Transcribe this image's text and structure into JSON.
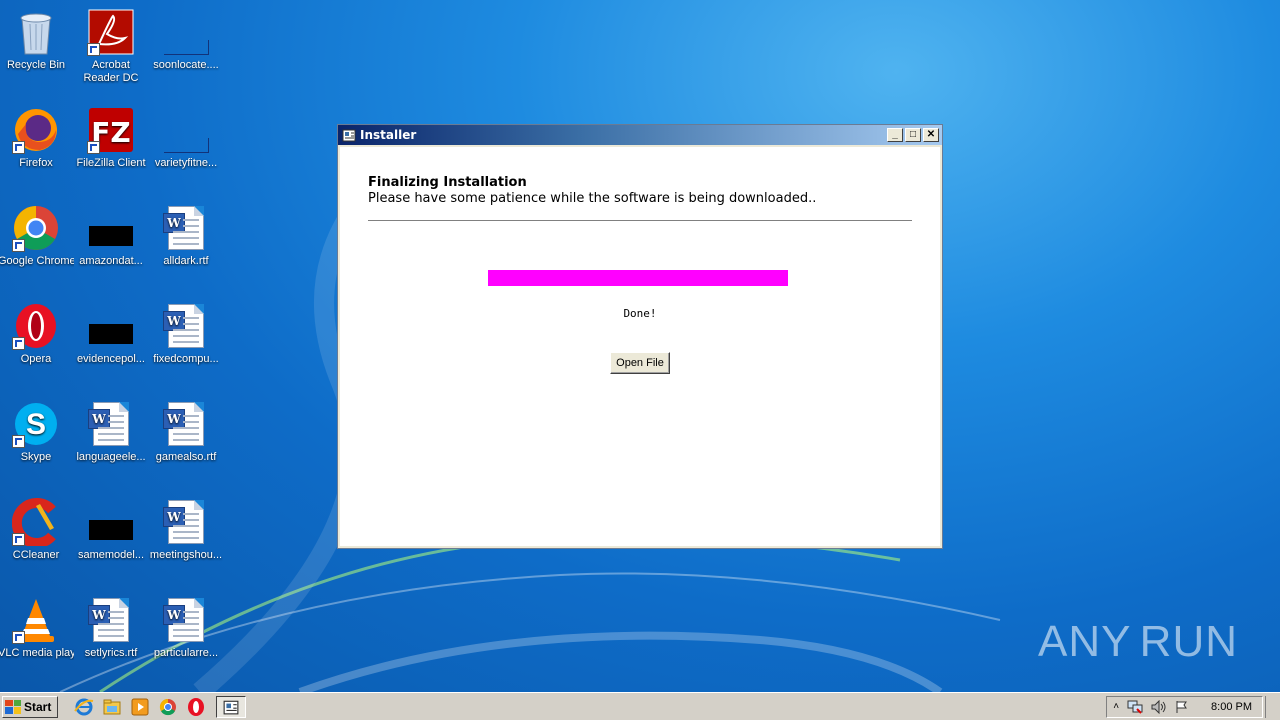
{
  "desktop": {
    "icons": [
      {
        "label": "Recycle Bin",
        "icon": "recycle-bin-icon"
      },
      {
        "label": "Acrobat Reader DC",
        "icon": "acrobat-icon"
      },
      {
        "label": "soonlocate....",
        "icon": "file-icon"
      },
      {
        "label": "Firefox",
        "icon": "firefox-icon"
      },
      {
        "label": "FileZilla Client",
        "icon": "filezilla-icon"
      },
      {
        "label": "varietyfitne...",
        "icon": "file-icon"
      },
      {
        "label": "Google Chrome",
        "icon": "chrome-icon"
      },
      {
        "label": "amazondat...",
        "icon": "file-icon"
      },
      {
        "label": "alldark.rtf",
        "icon": "word-document-icon"
      },
      {
        "label": "Opera",
        "icon": "opera-icon"
      },
      {
        "label": "evidencepol...",
        "icon": "file-icon"
      },
      {
        "label": "fixedcompu...",
        "icon": "word-document-icon"
      },
      {
        "label": "Skype",
        "icon": "skype-icon"
      },
      {
        "label": "languageele...",
        "icon": "word-document-icon"
      },
      {
        "label": "gamealso.rtf",
        "icon": "word-document-icon"
      },
      {
        "label": "CCleaner",
        "icon": "ccleaner-icon"
      },
      {
        "label": "samemodel...",
        "icon": "file-icon"
      },
      {
        "label": "meetingshou...",
        "icon": "word-document-icon"
      },
      {
        "label": "VLC media player",
        "icon": "vlc-icon"
      },
      {
        "label": "setlyrics.rtf",
        "icon": "word-document-icon"
      },
      {
        "label": "particularre...",
        "icon": "word-document-icon"
      }
    ]
  },
  "installer": {
    "title": "Installer",
    "heading": "Finalizing Installation",
    "subheading": "Please have some patience while the software is being downloaded..",
    "progress": 1.0,
    "progress_color": "#ff00ff",
    "status": "Done!",
    "open_button": "Open File"
  },
  "watermark": {
    "left": "ANY",
    "right": "RUN"
  },
  "taskbar": {
    "start_label": "Start",
    "clock": "8:00 PM"
  }
}
